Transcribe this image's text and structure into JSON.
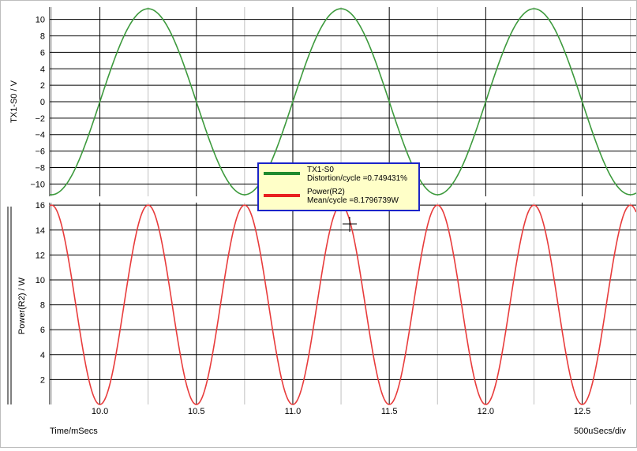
{
  "colors": {
    "tx1": "#3d9a3d",
    "power": "#e83c3c",
    "legend_border": "#1a24c8",
    "legend_bg": "#ffffc8",
    "grid": "#000000",
    "minor_grid": "#c0c0c0"
  },
  "axes": {
    "xlabel": "Time/mSecs",
    "x_scale_note": "500uSecs/div"
  },
  "legend": {
    "entries": [
      {
        "name": "TX1-S0",
        "stat": "Distortion/cycle =0.749431%"
      },
      {
        "name": "Power(R2)",
        "stat": "Mean/cycle =8.1796739W"
      }
    ]
  },
  "chart_data": [
    {
      "type": "line",
      "ylabel": "TX1-S0 / V",
      "xlim": [
        9.74,
        12.78
      ],
      "ylim": [
        -11.5,
        11.5
      ],
      "x_ticks": [
        "10.0",
        "10.5",
        "11.0",
        "11.5",
        "12.0",
        "12.5"
      ],
      "y_ticks": [
        -10,
        -8,
        -6,
        -4,
        -2,
        0,
        2,
        4,
        6,
        8,
        10
      ],
      "series": [
        {
          "name": "TX1-S0",
          "color": "#3d9a3d",
          "x": [
            9.75,
            9.875,
            10.0,
            10.125,
            10.25,
            10.375,
            10.5,
            10.625,
            10.75,
            10.875,
            11.0,
            11.125,
            11.25,
            11.375,
            11.5,
            11.625,
            11.75,
            11.875,
            12.0,
            12.125,
            12.25,
            12.375,
            12.5,
            12.625,
            12.75
          ],
          "y": [
            -11.3,
            -8.0,
            0.0,
            8.0,
            11.3,
            8.0,
            0.0,
            -8.0,
            -11.3,
            -8.0,
            0.0,
            8.0,
            11.3,
            8.0,
            0.0,
            -8.0,
            -11.3,
            -8.0,
            0.0,
            8.0,
            11.3,
            8.0,
            0.0,
            -8.0,
            -11.3
          ]
        }
      ]
    },
    {
      "type": "line",
      "ylabel": "Power(R2) / W",
      "xlim": [
        9.74,
        12.78
      ],
      "ylim": [
        0,
        16.2
      ],
      "x_ticks": [
        "10.0",
        "10.5",
        "11.0",
        "11.5",
        "12.0",
        "12.5"
      ],
      "y_ticks": [
        2,
        4,
        6,
        8,
        10,
        12,
        14,
        16
      ],
      "series": [
        {
          "name": "Power(R2)",
          "color": "#e83c3c",
          "x": [
            9.75,
            9.875,
            10.0,
            10.125,
            10.25,
            10.375,
            10.5,
            10.625,
            10.75,
            10.875,
            11.0,
            11.125,
            11.25,
            11.375,
            11.5,
            11.625,
            11.75,
            11.875,
            12.0,
            12.125,
            12.25,
            12.375,
            12.5,
            12.625,
            12.75
          ],
          "y": [
            16.0,
            8.0,
            0.0,
            8.0,
            16.0,
            8.0,
            0.0,
            8.0,
            16.0,
            8.0,
            0.0,
            8.0,
            16.0,
            8.0,
            0.0,
            8.0,
            16.0,
            8.0,
            0.0,
            8.0,
            16.0,
            8.0,
            0.0,
            8.0,
            16.0
          ]
        }
      ]
    }
  ]
}
